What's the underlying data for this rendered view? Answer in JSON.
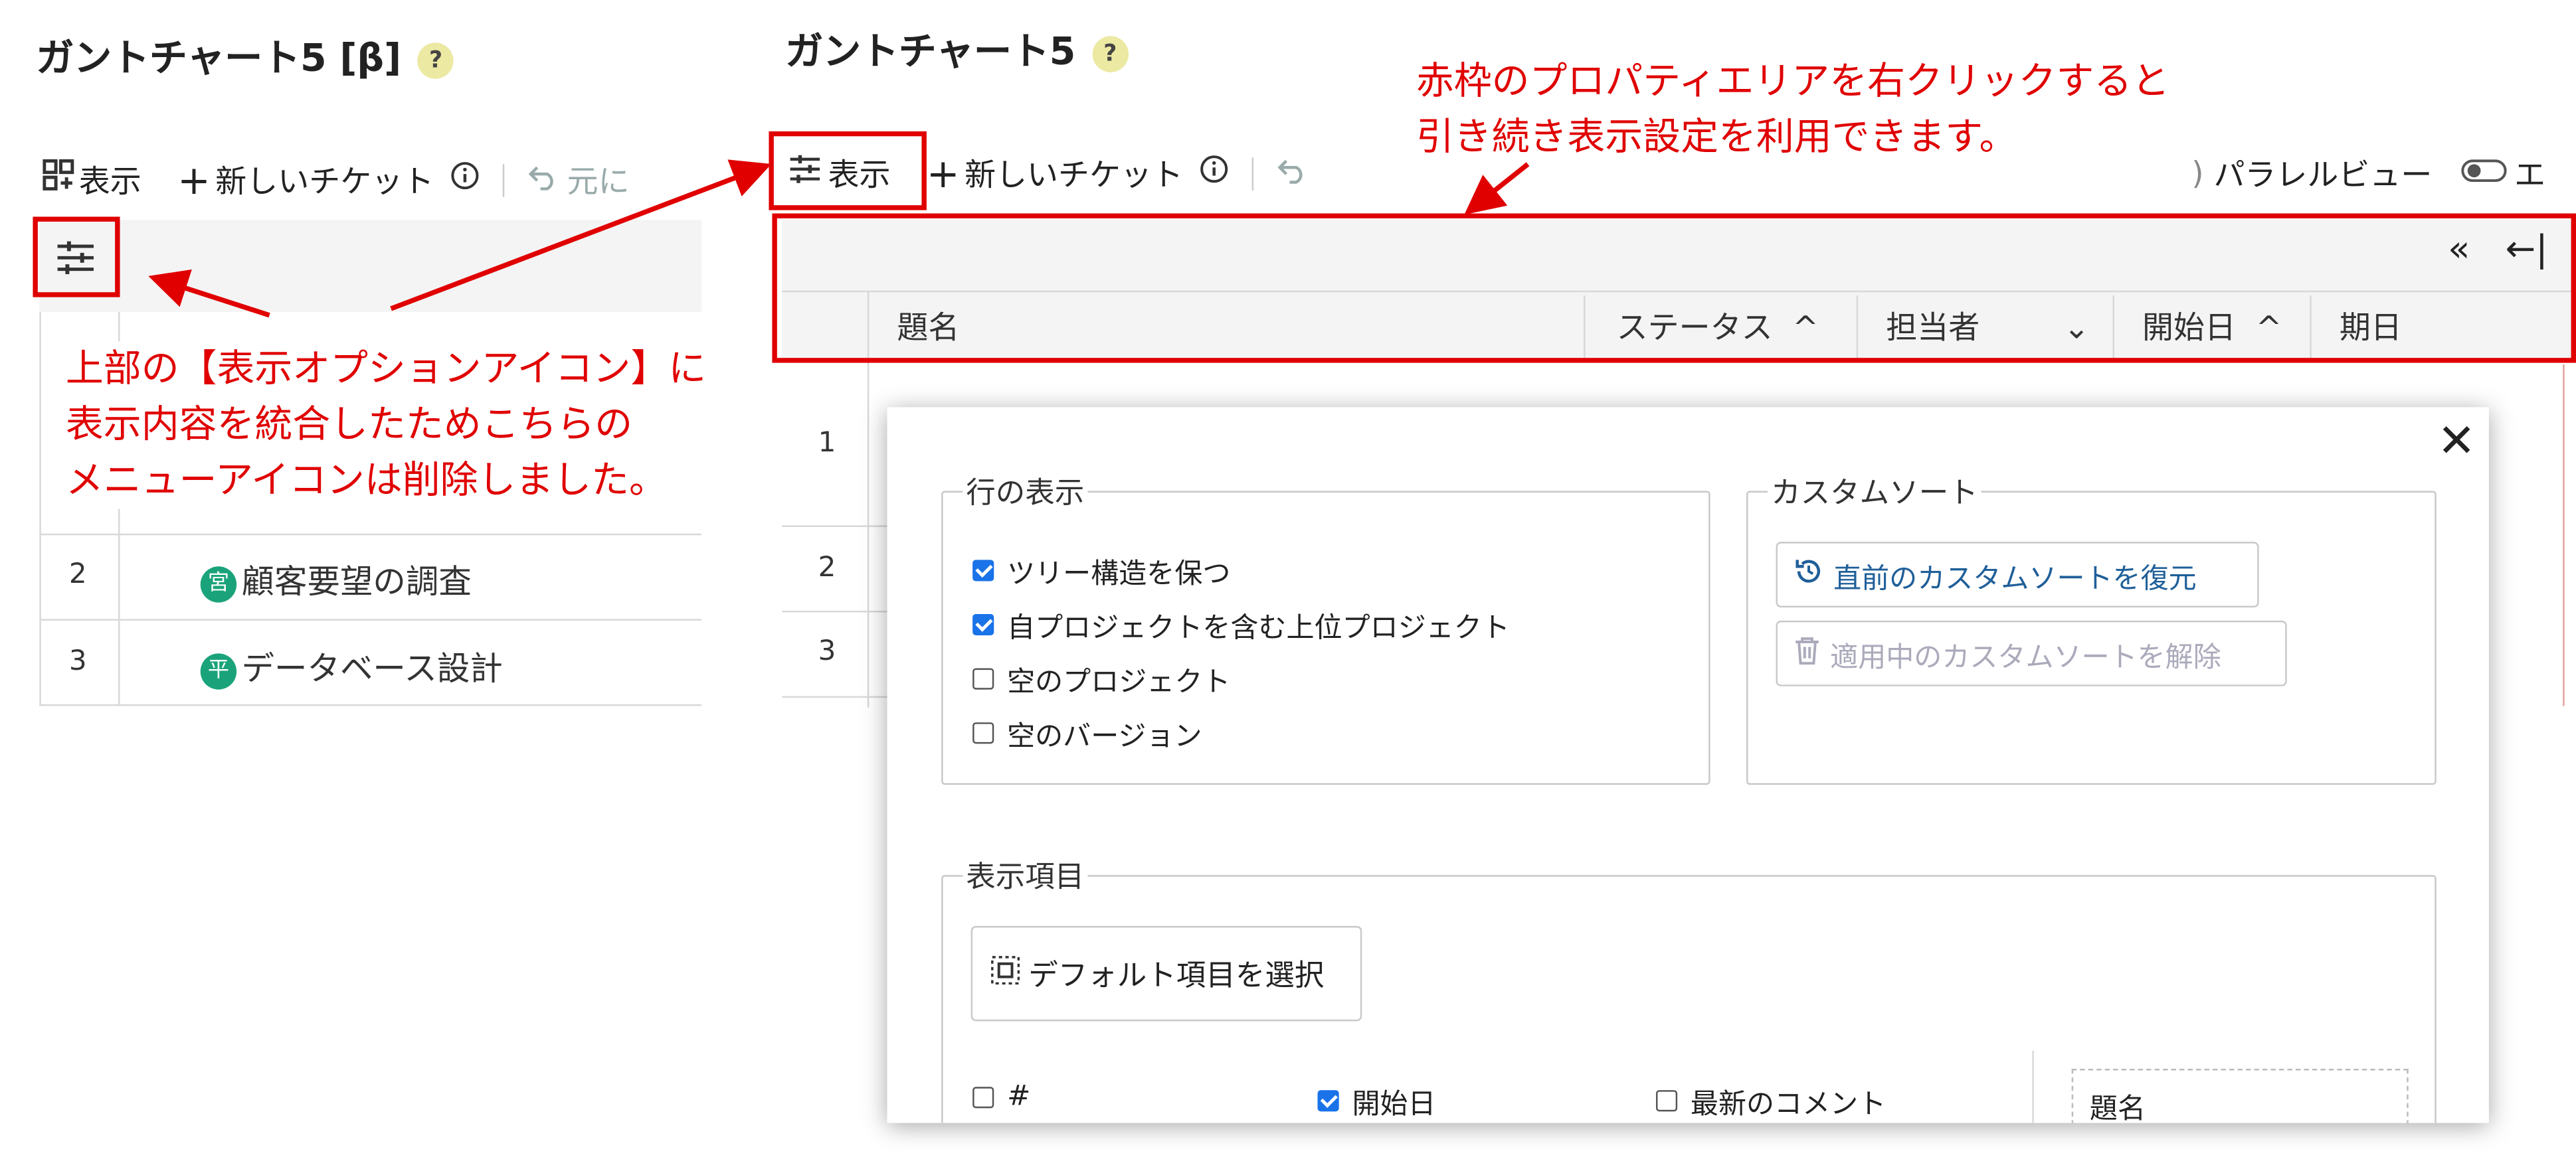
{
  "left_panel": {
    "title": "ガントチャート5 [β]",
    "help": "?",
    "toolbar": {
      "view_label": "表示",
      "new_ticket_label": "新しいチケット",
      "undo_label": "元に"
    },
    "rows": [
      {
        "num": "2",
        "badge": "宮",
        "text": "顧客要望の調査"
      },
      {
        "num": "3",
        "badge": "平",
        "text": "データベース設計"
      }
    ]
  },
  "annotation_left": {
    "lines": [
      "上部の【表示オプションアイコン】に",
      "表示内容を統合したためこちらの",
      "メニューアイコンは削除しました。"
    ]
  },
  "annotation_top": {
    "lines": [
      "赤枠のプロパティエリアを右クリックすると",
      "引き続き表示設定を利用できます。"
    ]
  },
  "right_panel": {
    "title": "ガントチャート5",
    "help": "?",
    "toolbar": {
      "view_label": "表示",
      "new_ticket_label": "新しいチケット",
      "parallel_view_label": "パラレルビュー",
      "cut_label": "エ"
    },
    "columns": {
      "subject": "題名",
      "status": "ステータス",
      "assignee": "担当者",
      "start_date": "開始日",
      "due_date": "期日"
    },
    "row_numbers": [
      "1",
      "2",
      "3"
    ]
  },
  "dialog": {
    "row_display": {
      "legend": "行の表示",
      "options": [
        {
          "label": "ツリー構造を保つ",
          "checked": true
        },
        {
          "label": "自プロジェクトを含む上位プロジェクト",
          "checked": true
        },
        {
          "label": "空のプロジェクト",
          "checked": false
        },
        {
          "label": "空のバージョン",
          "checked": false
        }
      ]
    },
    "custom_sort": {
      "legend": "カスタムソート",
      "restore_label": "直前のカスタムソートを復元",
      "clear_label": "適用中のカスタムソートを解除"
    },
    "display_items": {
      "legend": "表示項目",
      "default_button": "デフォルト項目を選択",
      "items": [
        {
          "label": "#",
          "checked": false
        },
        {
          "label": "開始日",
          "checked": true
        },
        {
          "label": "最新のコメント",
          "checked": false
        }
      ],
      "selected_first": "題名"
    }
  },
  "colors": {
    "annotation_red": "#e00000",
    "badge_green": "#1aa37a",
    "link_blue": "#1f5f99"
  }
}
